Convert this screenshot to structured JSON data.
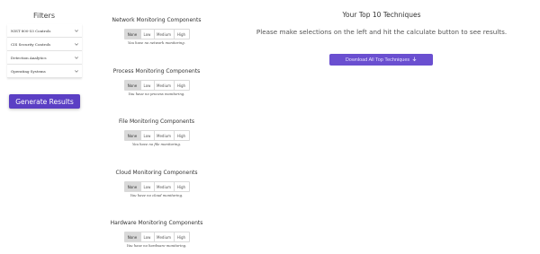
{
  "filters": {
    "title": "Filters",
    "items": [
      {
        "label": "NIST 800-53 Controls"
      },
      {
        "label": "CIS Security Controls"
      },
      {
        "label": "Detection Analytics"
      },
      {
        "label": "Operating Systems"
      }
    ],
    "generate_label": "Generate Results"
  },
  "levels": [
    "None",
    "Low",
    "Medium",
    "High"
  ],
  "selected_level": "None",
  "components": [
    {
      "title": "Network Monitoring Components",
      "note": "You have no network monitoring."
    },
    {
      "title": "Process Monitoring Components",
      "note": "You have no process monitoring."
    },
    {
      "title": "File Monitoring Components",
      "note": "You have no file monitoring."
    },
    {
      "title": "Cloud Monitoring Components",
      "note": "You have no cloud monitoring."
    },
    {
      "title": "Hardware Monitoring Components",
      "note": "You have no hardware monitoring."
    }
  ],
  "results": {
    "title": "Your Top 10 Techniques",
    "message": "Please make selections on the left and hit the calculate button to see results.",
    "download_label": "Download All Top Techniques"
  },
  "colors": {
    "accent": "#5b3fc4",
    "download": "#6a4fd0",
    "selected_segment": "#d9d9d9"
  },
  "icons": {
    "filter_item": "chevron-down-icon",
    "download": "download-arrow-icon"
  }
}
